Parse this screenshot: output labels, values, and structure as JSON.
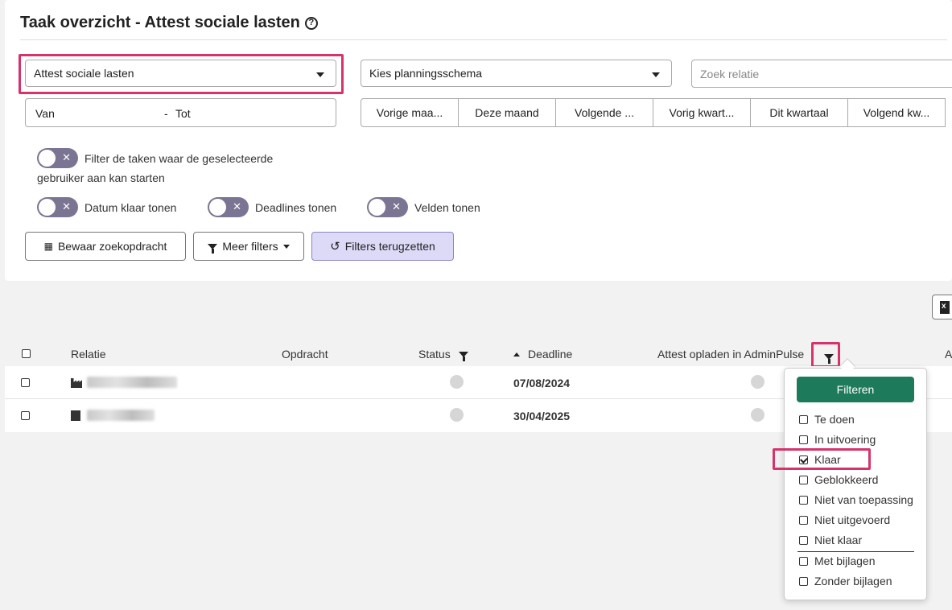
{
  "header": {
    "title": "Taak overzicht - Attest sociale lasten",
    "help_icon": "question-circle-icon"
  },
  "filters": {
    "task_type_select": "Attest sociale lasten",
    "planning_select": "Kies planningsschema",
    "search_placeholder": "Zoek relatie",
    "date_from": "Van",
    "date_separator": "-",
    "date_to": "Tot",
    "periods": [
      "Vorige maa...",
      "Deze maand",
      "Volgende ...",
      "Vorig kwart...",
      "Dit kwartaal",
      "Volgend kw..."
    ],
    "toggles": {
      "startable_line1": "Filter de taken waar de geselecteerde",
      "startable_line2": "gebruiker aan kan starten",
      "show_done_date": "Datum klaar tonen",
      "show_deadlines": "Deadlines tonen",
      "show_fields": "Velden tonen"
    },
    "buttons": {
      "save": "Bewaar zoekopdracht",
      "more": "Meer filters",
      "reset": "Filters terugzetten"
    }
  },
  "table": {
    "columns": {
      "relation": "Relatie",
      "assignment": "Opdracht",
      "status": "Status",
      "deadline": "Deadline",
      "upload": "Attest opladen in AdminPulse",
      "extra": "A"
    },
    "rows": [
      {
        "deadline": "07/08/2024"
      },
      {
        "deadline": "30/04/2025"
      }
    ]
  },
  "status_filter": {
    "apply_label": "Filteren",
    "options": [
      {
        "label": "Te doen",
        "checked": false
      },
      {
        "label": "In uitvoering",
        "checked": false
      },
      {
        "label": "Klaar",
        "checked": true
      },
      {
        "label": "Geblokkeerd",
        "checked": false
      },
      {
        "label": "Niet van toepassing",
        "checked": false
      },
      {
        "label": "Niet uitgevoerd",
        "checked": false
      },
      {
        "label": "Niet klaar",
        "checked": false
      }
    ],
    "attachment_options": [
      {
        "label": "Met bijlagen",
        "checked": false
      },
      {
        "label": "Zonder bijlagen",
        "checked": false
      }
    ]
  },
  "colors": {
    "highlight": "#d6336c",
    "apply_button": "#1d7a5b",
    "reset_button": "#dcdaf7",
    "toggle_off": "#7b7593"
  }
}
